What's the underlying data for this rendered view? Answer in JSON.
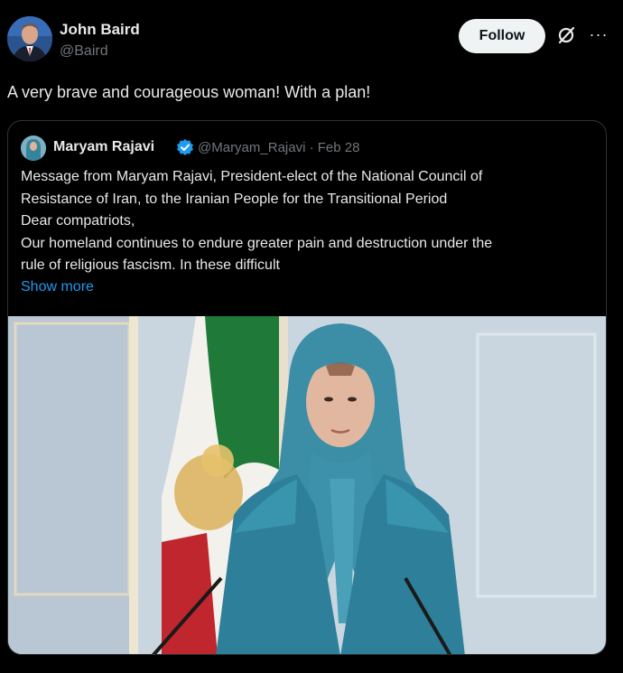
{
  "author": {
    "name": "John Baird",
    "handle": "@Baird",
    "avatar_icon": "avatar"
  },
  "actions": {
    "follow_label": "Follow",
    "grok_icon": "grok-icon",
    "more_label": "···"
  },
  "tweet": {
    "text": "A very brave and courageous woman! With a plan!"
  },
  "quoted": {
    "name": "Maryam Rajavi",
    "verified_icon": "verified-badge-icon",
    "handle_date": "@Maryam_Rajavi · Feb 28",
    "lines": [
      "Message from Maryam Rajavi, President-elect of the National Council of",
      "Resistance of Iran, to the Iranian People for the Transitional Period",
      "Dear compatriots,",
      "Our homeland continues to endure greater pain and destruction under the",
      "rule of religious fascism. In these difficult"
    ],
    "show_more": "Show more"
  },
  "colors": {
    "background": "#000000",
    "text": "#e7e9ea",
    "secondary": "#71767b",
    "link": "#1d9bf0",
    "border": "#2f3336",
    "follow_bg": "#eff3f4"
  }
}
